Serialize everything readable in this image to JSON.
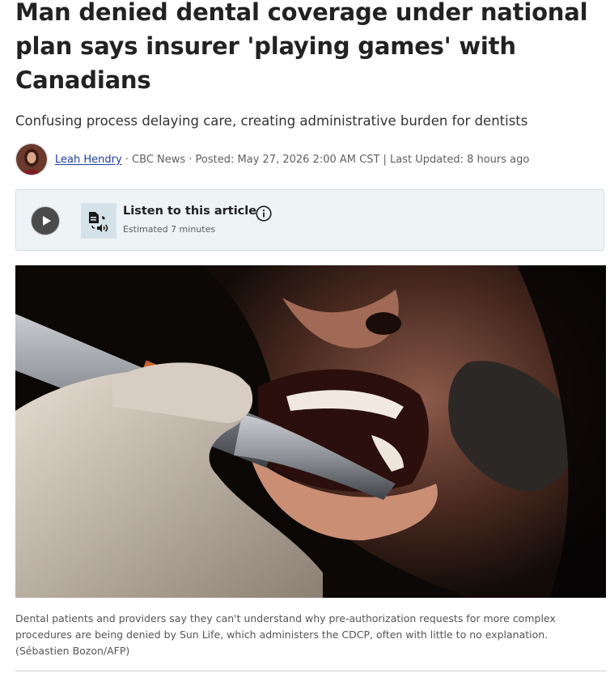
{
  "article": {
    "headline": "Man denied dental coverage under national plan says insurer 'playing games' with Canadians",
    "deck": "Confusing process delaying care, creating administrative burden for dentists"
  },
  "byline": {
    "author": "Leah Hendry",
    "source": " · CBC News · Posted: May 27, 2026 2:00 AM CST | Last Updated: 8 hours ago"
  },
  "audio": {
    "title": "Listen to this article",
    "estimate": "Estimated 7 minutes",
    "play_icon": "play-icon",
    "tts_icon": "text-to-speech-icon",
    "info_icon": "info-icon"
  },
  "image": {
    "caption": "Dental patients and providers say they can't understand why pre-authorization requests for more complex procedures are being denied by Sun Life, which administers the CDCP, often with little to no explanation.",
    "credit": "(Sébastien Bozon/AFP)"
  },
  "colors": {
    "link": "#1f3da0",
    "audio_bg": "#eef3f6",
    "play_button": "#4b4b4b"
  }
}
